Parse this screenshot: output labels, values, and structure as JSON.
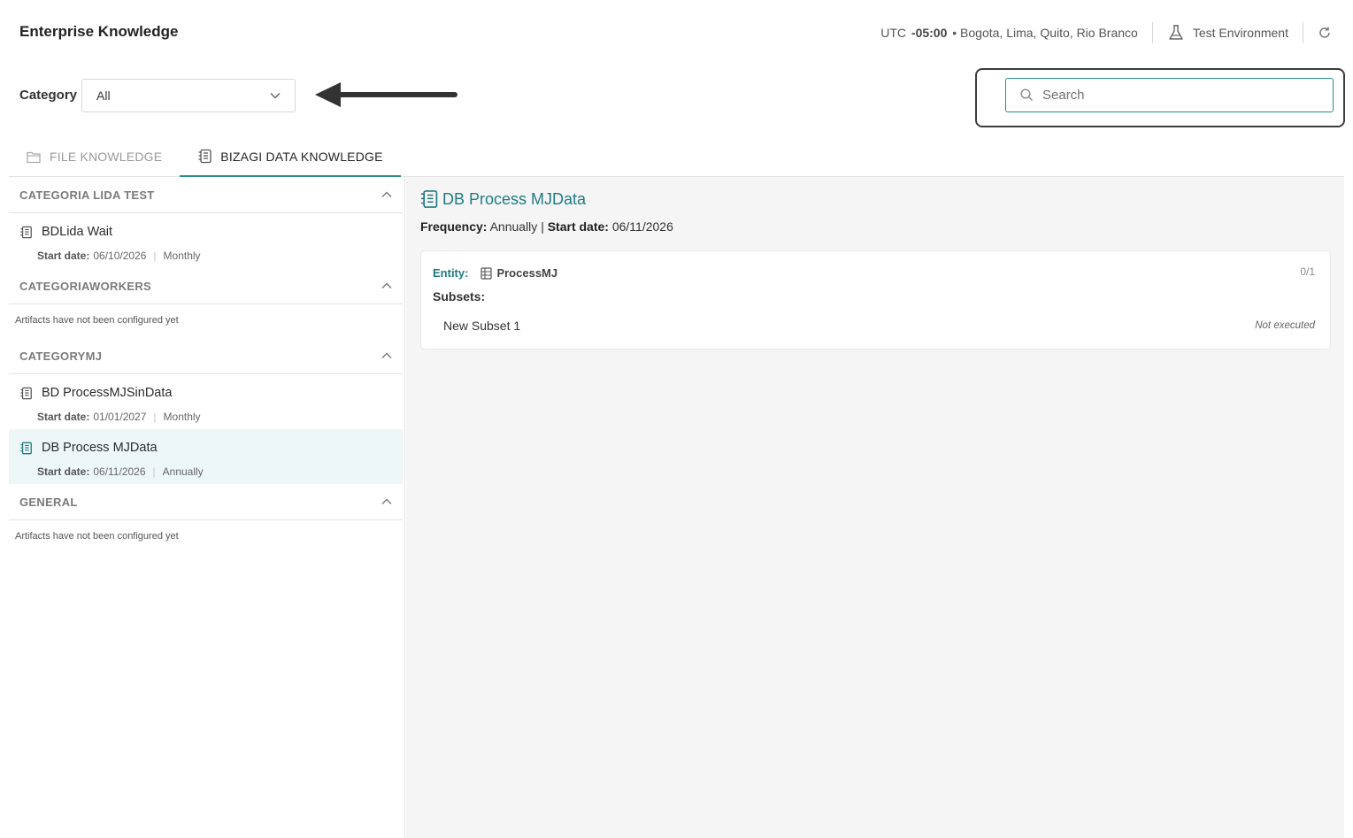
{
  "header": {
    "title": "Enterprise Knowledge",
    "timezone_prefix": "UTC",
    "timezone_offset": "-05:00",
    "timezone_cities": "• Bogota, Lima, Quito, Rio Branco",
    "environment": "Test Environment",
    "icons": [
      "flask-icon",
      "refresh-icon"
    ]
  },
  "filter": {
    "category_label": "Category",
    "category_value": "All"
  },
  "search": {
    "placeholder": "Search"
  },
  "tabs": [
    {
      "label": "FILE KNOWLEDGE",
      "icon": "folder-icon",
      "active": false
    },
    {
      "label": "BIZAGI DATA KNOWLEDGE",
      "icon": "data-document-icon",
      "active": true
    }
  ],
  "categories": [
    {
      "name": "CATEGORIA LIDA TEST",
      "items": [
        {
          "title": "BDLida Wait",
          "start_label": "Start date:",
          "start_date": "06/10/2026",
          "frequency": "Monthly"
        }
      ]
    },
    {
      "name": "CATEGORIAWORKERS",
      "empty_text": "Artifacts have not been configured yet"
    },
    {
      "name": "CATEGORYMJ",
      "items": [
        {
          "title": "BD ProcessMJSinData",
          "start_label": "Start date:",
          "start_date": "01/01/2027",
          "frequency": "Monthly"
        },
        {
          "title": "DB Process MJData",
          "start_label": "Start date:",
          "start_date": "06/11/2026",
          "frequency": "Annually",
          "selected": true
        }
      ]
    },
    {
      "name": "GENERAL",
      "empty_text": "Artifacts have not been configured yet"
    }
  ],
  "detail": {
    "title": "DB Process MJData",
    "frequency_label": "Frequency:",
    "frequency": "Annually",
    "divider": "|",
    "start_label": "Start date:",
    "start_date": "06/11/2026",
    "entity_label": "Entity:",
    "entity_name": "ProcessMJ",
    "entity_count": "0/1",
    "subsets_label": "Subsets:",
    "subsets": [
      {
        "name": "New Subset 1",
        "status": "Not executed"
      }
    ]
  },
  "colors": {
    "accent": "#2a8c8c",
    "title_teal": "#1f7b82",
    "selected_bg": "#eef7f7"
  }
}
